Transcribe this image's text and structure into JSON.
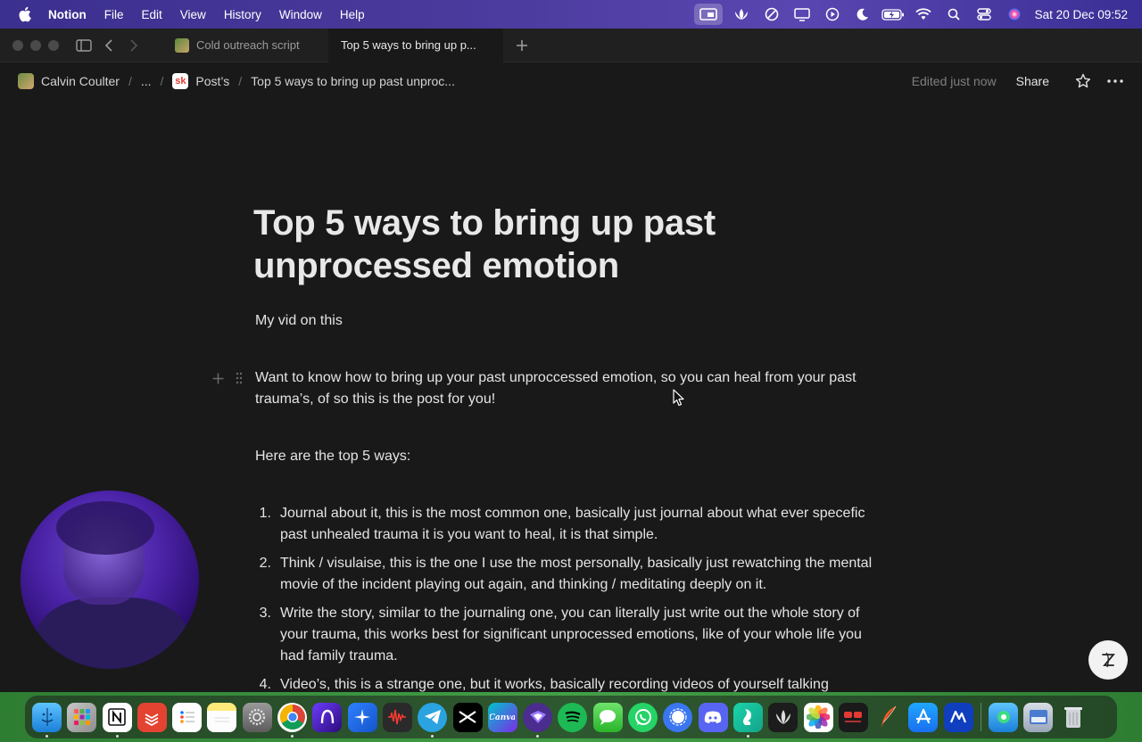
{
  "menubar": {
    "app_name": "Notion",
    "menus": [
      "File",
      "Edit",
      "View",
      "History",
      "Window",
      "Help"
    ],
    "clock": "Sat 20 Dec  09:52",
    "status_icons": [
      "screen-share-icon",
      "lotus-icon",
      "focus-icon",
      "display-icon",
      "play-icon",
      "moon-icon",
      "battery-icon",
      "wifi-icon",
      "search-icon",
      "control-center-icon",
      "siri-icon"
    ]
  },
  "tabs": [
    {
      "label": "Cold outreach script",
      "active": false
    },
    {
      "label": "Top 5 ways to bring up p...",
      "active": true
    }
  ],
  "breadcrumb": {
    "workspace": "Calvin Coulter",
    "ellipsis": "...",
    "parent": "Post’s",
    "parent_badge": "sk",
    "current": "Top 5 ways to bring up past unproc..."
  },
  "topbar": {
    "edited": "Edited just now",
    "share": "Share"
  },
  "doc": {
    "title": "Top 5 ways to bring up past unprocessed emotion",
    "subtitle": "My vid on this",
    "intro": "Want to know how to bring up your past unproccessed emotion, so you can heal from your past trauma’s, of so this is the post for you!",
    "here": "Here are the top 5 ways:",
    "list": [
      {
        "num": "1.",
        "text": "Journal about it, this is the most common one, basically just journal about what ever specefic past unhealed trauma it is you want to heal, it is that simple."
      },
      {
        "num": "2.",
        "text": "Think / visulaise, this is the one I use the most personally, basically just rewatching the mental movie of the incident playing out again, and thinking / meditating deeply on it."
      },
      {
        "num": "3.",
        "text": "Write the story, similar to the journaling one, you can literally just write out the whole story of your trauma, this works best for significant unprocessed emotions, like of your whole life you had family trauma."
      },
      {
        "num": "4.",
        "text": "Video’s, this is a strange one, but it works, basically recording videos of yourself talking"
      }
    ]
  },
  "help_button": "?",
  "dock": {
    "apps": [
      "finder-icon",
      "launchpad-icon",
      "notion-icon",
      "todoist-icon",
      "reminders-icon",
      "notes-icon",
      "settings-icon",
      "chrome-icon",
      "arc-icon",
      "spark-icon",
      "voice-memos-icon",
      "telegram-icon",
      "capcut-icon",
      "canva-icon",
      "proton-vpn-icon",
      "spotify-icon",
      "messages-icon",
      "whatsapp-icon",
      "signal-icon",
      "discord-icon",
      "surfshark-icon",
      "lotus-app-icon",
      "photos-icon",
      "youtube-studio-icon",
      "quill-icon",
      "app-store-icon",
      "wisprflow-icon",
      "finder-alt-icon",
      "preview-icon",
      "trash-icon"
    ]
  }
}
